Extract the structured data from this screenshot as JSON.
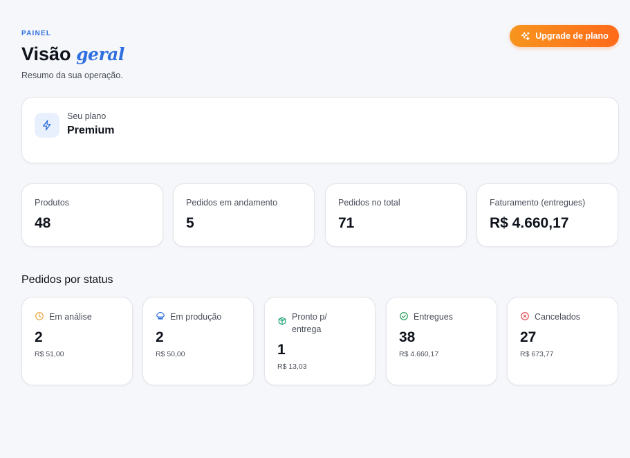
{
  "header": {
    "eyebrow": "PAINEL",
    "title_main": "Visão",
    "title_accent": "geral",
    "subtitle": "Resumo da sua operação."
  },
  "upgrade_button": {
    "label": "Upgrade de plano",
    "icon": "sparkles-icon",
    "color_start": "#f7951d",
    "color_end": "#ff6a1a"
  },
  "plan": {
    "label": "Seu plano",
    "name": "Premium",
    "icon": "lightning-icon"
  },
  "stats": [
    {
      "label": "Produtos",
      "value": "48"
    },
    {
      "label": "Pedidos em andamento",
      "value": "5"
    },
    {
      "label": "Pedidos no total",
      "value": "71"
    },
    {
      "label": "Faturamento (entregues)",
      "value": "R$ 4.660,17"
    }
  ],
  "status_section": {
    "title": "Pedidos por status"
  },
  "statuses": [
    {
      "label": "Em análise",
      "count": "2",
      "amount": "R$ 51,00",
      "icon": "clock-icon",
      "color": "#e8a13a"
    },
    {
      "label": "Em produção",
      "count": "2",
      "amount": "R$ 50,00",
      "icon": "chef-hat-icon",
      "color": "#2f6fdf"
    },
    {
      "label": "Pronto p/ entrega",
      "count": "1",
      "amount": "R$ 13,03",
      "icon": "package-icon",
      "color": "#22a37a"
    },
    {
      "label": "Entregues",
      "count": "38",
      "amount": "R$ 4.660,17",
      "icon": "check-circle-icon",
      "color": "#1f9d55"
    },
    {
      "label": "Cancelados",
      "count": "27",
      "amount": "R$ 673,77",
      "icon": "x-circle-icon",
      "color": "#e0474c"
    }
  ],
  "colors": {
    "accent": "#2f6fdf",
    "background": "#f6f7fa"
  }
}
